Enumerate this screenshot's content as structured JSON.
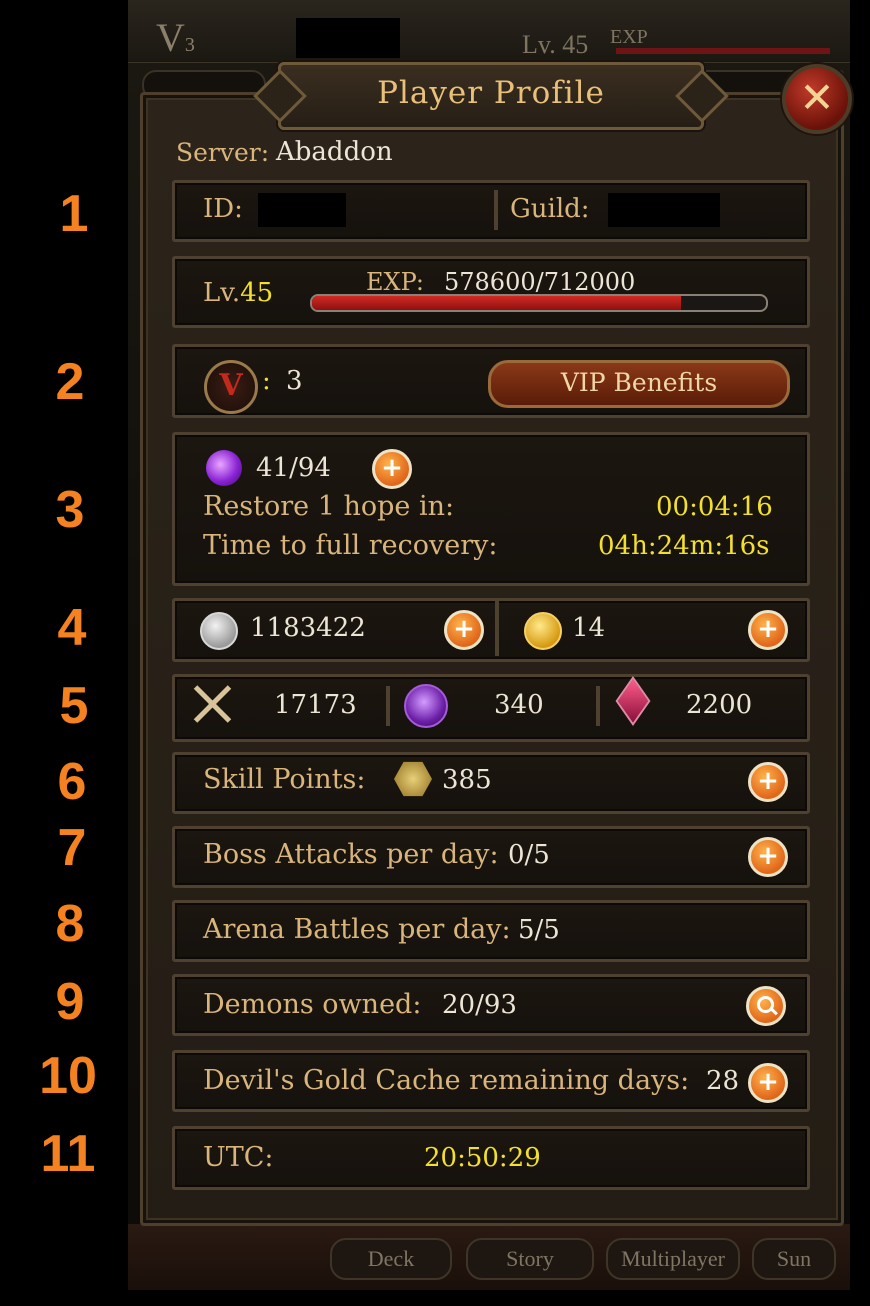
{
  "background": {
    "vip_level": "V",
    "vip_sub": "3",
    "level": "Lv. 45",
    "exp_label": "EXP",
    "nav_tabs": [
      "Deck",
      "Story",
      "Multiplayer",
      "Sun"
    ]
  },
  "row_numbers": [
    "1",
    "2",
    "3",
    "4",
    "5",
    "6",
    "7",
    "8",
    "9",
    "10",
    "11"
  ],
  "profile": {
    "title": "Player Profile",
    "close_icon": "close-x-icon",
    "server_label": "Server:",
    "server_value": "Abaddon",
    "id_label": "ID:",
    "guild_label": "Guild:",
    "level_prefix": "Lv.",
    "level_value": "45",
    "exp_label": "EXP:",
    "exp_value": "578600/712000",
    "exp_fraction": 0.8126,
    "vip_badge": "V",
    "vip_colon": ":",
    "vip_level": "3",
    "vip_button": "VIP Benefits",
    "hope_value": "41/94",
    "restore_label": "Restore 1 hope in:",
    "restore_time": "00:04:16",
    "full_recovery_label": "Time to full recovery:",
    "full_recovery_time": "04h:24m:16s",
    "silver_value": "1183422",
    "gold_value": "14",
    "battle_points": "17173",
    "soul_value": "340",
    "gem_value": "2200",
    "skill_label": "Skill Points:",
    "skill_value": "385",
    "boss_label": "Boss Attacks per day:",
    "boss_value": "0/5",
    "arena_label": "Arena Battles per day:",
    "arena_value": "5/5",
    "demons_label": "Demons owned:",
    "demons_value": "20/93",
    "cache_label": "Devil's Gold Cache remaining days:",
    "cache_value": "28",
    "utc_label": "UTC:",
    "utc_value": "20:50:29"
  },
  "colors": {
    "annotation_orange": "#f58220",
    "label_gold": "#d9b57c",
    "time_yellow": "#f3e02c",
    "exp_red": "#c81e1e"
  }
}
